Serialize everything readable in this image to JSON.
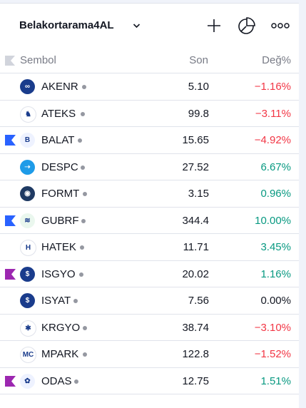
{
  "watchlist": {
    "title": "Belakortarama4AL",
    "icons": [
      "plus-icon",
      "pie-chart-icon",
      "more-icon"
    ]
  },
  "columns": {
    "symbol": "Sembol",
    "last": "Son",
    "change": "Değ%"
  },
  "colors": {
    "negative": "#f23645",
    "positive": "#089981",
    "neutral": "#131722",
    "flag_blue": "#2962ff",
    "flag_purple": "#9c27b0",
    "flag_gray": "#d1d4dc"
  },
  "rows": [
    {
      "symbol": "AKENR",
      "last": "5.10",
      "change": "−1.16%",
      "trend": "negative",
      "flag": "",
      "logo_bg": "#1a3c8c",
      "logo_text": "∞"
    },
    {
      "symbol": "ATEKS",
      "last": "99.8",
      "change": "−3.11%",
      "trend": "negative",
      "flag": "",
      "logo_bg": "#ffffff",
      "logo_text": "♞"
    },
    {
      "symbol": "BALAT",
      "last": "15.65",
      "change": "−4.92%",
      "trend": "negative",
      "flag": "blue",
      "logo_bg": "#eef2ff",
      "logo_text": "B"
    },
    {
      "symbol": "DESPC",
      "last": "27.52",
      "change": "6.67%",
      "trend": "positive",
      "flag": "",
      "logo_bg": "#1e9be8",
      "logo_text": "➝"
    },
    {
      "symbol": "FORMT",
      "last": "3.15",
      "change": "0.96%",
      "trend": "positive",
      "flag": "",
      "logo_bg": "#1f3a63",
      "logo_text": "◉"
    },
    {
      "symbol": "GUBRF",
      "last": "344.4",
      "change": "10.00%",
      "trend": "positive",
      "flag": "blue",
      "logo_bg": "#eaf7ee",
      "logo_text": "≋"
    },
    {
      "symbol": "HATEK",
      "last": "11.71",
      "change": "3.45%",
      "trend": "positive",
      "flag": "",
      "logo_bg": "#ffffff",
      "logo_text": "H"
    },
    {
      "symbol": "ISGYO",
      "last": "20.02",
      "change": "1.16%",
      "trend": "positive",
      "flag": "purple",
      "logo_bg": "#1a3c8c",
      "logo_text": "$"
    },
    {
      "symbol": "ISYAT",
      "last": "7.56",
      "change": "0.00%",
      "trend": "neutral",
      "flag": "",
      "logo_bg": "#1a3c8c",
      "logo_text": "$"
    },
    {
      "symbol": "KRGYO",
      "last": "38.74",
      "change": "−3.10%",
      "trend": "negative",
      "flag": "",
      "logo_bg": "#ffffff",
      "logo_text": "✱"
    },
    {
      "symbol": "MPARK",
      "last": "122.8",
      "change": "−1.52%",
      "trend": "negative",
      "flag": "",
      "logo_bg": "#ffffff",
      "logo_text": "MC"
    },
    {
      "symbol": "ODAS",
      "last": "12.75",
      "change": "1.51%",
      "trend": "positive",
      "flag": "purple",
      "logo_bg": "#eef2ff",
      "logo_text": "✿"
    }
  ]
}
